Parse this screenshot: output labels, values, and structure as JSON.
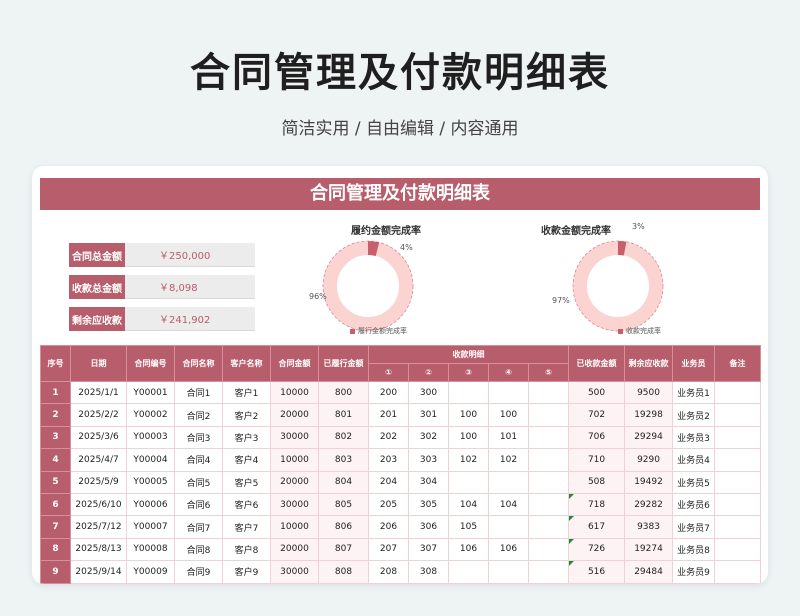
{
  "hero": {
    "title": "合同管理及付款明细表",
    "subtitle": "简洁实用 / 自由编辑 / 内容通用"
  },
  "sheet": {
    "title": "合同管理及付款明细表"
  },
  "summary": [
    {
      "label": "合同总金额",
      "value": "￥250,000"
    },
    {
      "label": "收款总金额",
      "value": "￥8,098"
    },
    {
      "label": "剩余应收款",
      "value": "￥241,902"
    }
  ],
  "chart_data": [
    {
      "type": "pie",
      "title": "履约金额完成率",
      "categories": [
        "4%",
        "96%"
      ],
      "values": [
        4,
        96
      ],
      "legend": "履行金额完成率",
      "colors": [
        "#c75f6b",
        "#fbd4d2"
      ]
    },
    {
      "type": "pie",
      "title": "收款金额完成率",
      "categories": [
        "3%",
        "97%"
      ],
      "values": [
        3,
        97
      ],
      "legend": "收款完成率",
      "colors": [
        "#c75f6b",
        "#fbd4d2"
      ]
    }
  ],
  "table": {
    "headers": [
      "序号",
      "日期",
      "合同编号",
      "合同名称",
      "客户名称",
      "合同金额",
      "已履行金额",
      "收款明细",
      "已收款金额",
      "剩余应收款",
      "业务员",
      "备注"
    ],
    "sub_headers": [
      "①",
      "②",
      "③",
      "④",
      "⑤"
    ],
    "rows": [
      [
        "1",
        "2025/1/1",
        "Y00001",
        "合同1",
        "客户1",
        "10000",
        "800",
        "200",
        "300",
        "",
        "",
        "",
        "500",
        "9500",
        "业务员1",
        ""
      ],
      [
        "2",
        "2025/2/2",
        "Y00002",
        "合同2",
        "客户2",
        "20000",
        "801",
        "201",
        "301",
        "100",
        "100",
        "",
        "702",
        "19298",
        "业务员2",
        ""
      ],
      [
        "3",
        "2025/3/6",
        "Y00003",
        "合同3",
        "客户3",
        "30000",
        "802",
        "202",
        "302",
        "100",
        "101",
        "",
        "706",
        "29294",
        "业务员3",
        ""
      ],
      [
        "4",
        "2025/4/7",
        "Y00004",
        "合同4",
        "客户4",
        "10000",
        "803",
        "203",
        "303",
        "102",
        "102",
        "",
        "710",
        "9290",
        "业务员4",
        ""
      ],
      [
        "5",
        "2025/5/9",
        "Y00005",
        "合同5",
        "客户5",
        "20000",
        "804",
        "204",
        "304",
        "",
        "",
        "",
        "508",
        "19492",
        "业务员5",
        ""
      ],
      [
        "6",
        "2025/6/10",
        "Y00006",
        "合同6",
        "客户6",
        "30000",
        "805",
        "205",
        "305",
        "104",
        "104",
        "",
        "718",
        "29282",
        "业务员6",
        ""
      ],
      [
        "7",
        "2025/7/12",
        "Y00007",
        "合同7",
        "客户7",
        "10000",
        "806",
        "206",
        "306",
        "105",
        "",
        "",
        "617",
        "9383",
        "业务员7",
        ""
      ],
      [
        "8",
        "2025/8/13",
        "Y00008",
        "合同8",
        "客户8",
        "20000",
        "807",
        "207",
        "307",
        "106",
        "106",
        "",
        "726",
        "19274",
        "业务员8",
        ""
      ],
      [
        "9",
        "2025/9/14",
        "Y00009",
        "合同9",
        "客户9",
        "30000",
        "808",
        "208",
        "308",
        "",
        "",
        "",
        "516",
        "29484",
        "业务员9",
        ""
      ]
    ],
    "flagged_rows": [
      6,
      7,
      8,
      9
    ]
  }
}
